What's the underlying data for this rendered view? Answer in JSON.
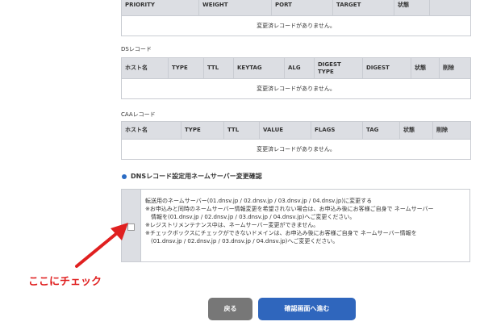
{
  "srv_table": {
    "headers": [
      "PRIORITY",
      "WEIGHT",
      "PORT",
      "TARGET",
      "状態"
    ],
    "empty_message": "変更済レコードがありません。"
  },
  "ds_section": {
    "label": "DSレコード",
    "headers": [
      "ホスト名",
      "TYPE",
      "TTL",
      "KEYTAG",
      "ALG",
      "DIGEST TYPE",
      "DIGEST",
      "状態",
      "削除"
    ],
    "empty_message": "変更済レコードがありません。"
  },
  "caa_section": {
    "label": "CAAレコード",
    "headers": [
      "ホスト名",
      "TYPE",
      "TTL",
      "VALUE",
      "FLAGS",
      "TAG",
      "状態",
      "削除"
    ],
    "empty_message": "変更済レコードがありません。"
  },
  "confirm": {
    "title": "DNSレコード設定用ネームサーバー変更確認",
    "lines": [
      "転送用のネームサーバー(01.dnsv.jp / 02.dnsv.jp / 03.dnsv.jp / 04.dnsv.jp)に変更する",
      "※お申込みと同時のネームサーバー情報変更を希望されない場合は、お申込み後にお客様ご自身で ネームサーバー",
      "　情報を(01.dnsv.jp / 02.dnsv.jp / 03.dnsv.jp / 04.dnsv.jp)へご変更ください。",
      "※レジストリメンテナンス中は、ネームサーバー変更ができません。",
      "※チェックボックスにチェックができないドメインは、お申込み後にお客様ご自身で ネームサーバー情報を",
      "　(01.dnsv.jp / 02.dnsv.jp / 03.dnsv.jp / 04.dnsv.jp)へご変更ください。"
    ]
  },
  "annotation": "ここにチェック",
  "buttons": {
    "back": "戻る",
    "next": "確認画面へ進む"
  },
  "colors": {
    "header_bg": "#dcdee3",
    "primary_button": "#2f66bd",
    "back_button": "#777777",
    "annotation": "#e02020",
    "section_dot": "#2b6cc4"
  }
}
